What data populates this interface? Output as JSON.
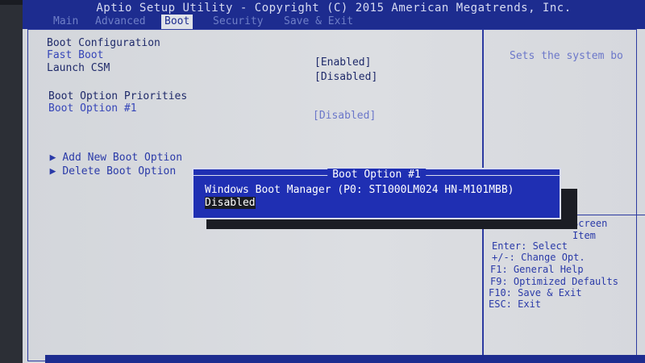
{
  "title": "Aptio Setup Utility - Copyright (C) 2015 American Megatrends, Inc.",
  "tabs": [
    {
      "label": "Main",
      "active": false
    },
    {
      "label": "Advanced",
      "active": false
    },
    {
      "label": "Boot",
      "active": true
    },
    {
      "label": "Security",
      "active": false
    },
    {
      "label": "Save & Exit",
      "active": false
    }
  ],
  "boot": {
    "section_config": "Boot Configuration",
    "fast_boot": {
      "label": "Fast Boot",
      "value": "[Enabled]"
    },
    "launch_csm": {
      "label": "Launch CSM",
      "value": "[Disabled]"
    },
    "section_priorities": "Boot Option Priorities",
    "boot_option_1": {
      "label": "Boot Option #1",
      "value": "[Disabled]"
    },
    "add_new": "Add New Boot Option",
    "delete": "Delete Boot Option"
  },
  "help": {
    "text": "Sets the system bo",
    "keys": [
      "Screen",
      "Item",
      "Enter: Select",
      "+/-: Change Opt.",
      "F1: General Help",
      "F9: Optimized Defaults",
      "F10: Save & Exit",
      "ESC: Exit"
    ]
  },
  "popup": {
    "title": "Boot Option #1",
    "options": [
      "Windows Boot Manager (P0: ST1000LM024 HN-M101MBB)",
      "Disabled"
    ],
    "selected": "Disabled"
  },
  "colors": {
    "accent": "#1d2c8f",
    "popup_bg": "#1f2fb3",
    "screen_bg": "#d8dadf"
  }
}
